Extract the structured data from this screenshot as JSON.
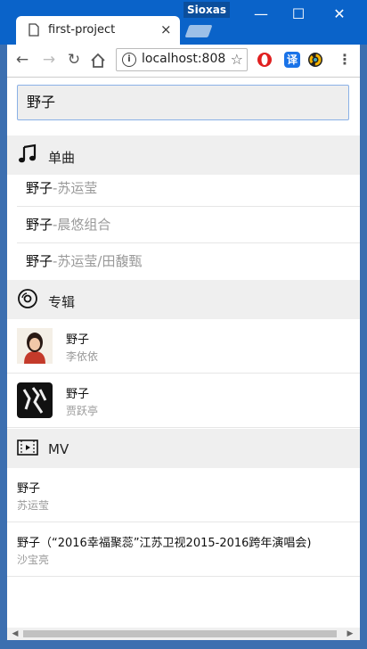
{
  "window": {
    "profile_name": "Sioxas"
  },
  "tab": {
    "title": "first-project",
    "close": "×"
  },
  "toolbar": {
    "url": "localhost:808"
  },
  "extensions": {
    "translate_label": "译"
  },
  "search": {
    "value": "野子"
  },
  "sections": {
    "songs": {
      "title": "单曲"
    },
    "albums": {
      "title": "专辑"
    },
    "mv": {
      "title": "MV"
    }
  },
  "songs": [
    {
      "name": "野子",
      "artist": "-苏运莹"
    },
    {
      "name": "野子",
      "artist": "-晨悠组合"
    },
    {
      "name": "野子",
      "artist": "-苏运莹/田馥甄"
    }
  ],
  "albums": [
    {
      "name": "野子",
      "artist": "李依依"
    },
    {
      "name": "野子",
      "artist": "贾跃亭"
    }
  ],
  "mvs": [
    {
      "name": "野子",
      "artist": "苏运莹"
    },
    {
      "name": "野子（“2016幸福聚蕊”江苏卫视2015-2016跨年演唱会)",
      "artist": "沙宝亮"
    }
  ],
  "colors": {
    "titlebar": "#0a63c9",
    "accent": "#8ab0e6",
    "section_bg": "#efefef",
    "muted": "#999999"
  }
}
